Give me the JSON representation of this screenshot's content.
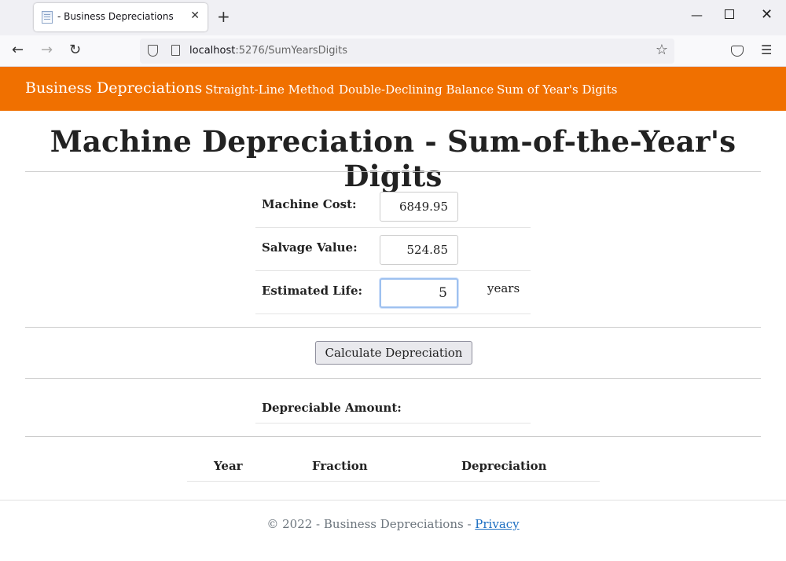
{
  "browser": {
    "tab_title": "- Business Depreciations",
    "tab_close": "✕",
    "new_tab": "+",
    "url_host": "localhost",
    "url_rest": ":5276/SumYearsDigits",
    "icons": [
      "back-arrow-icon",
      "forward-arrow-icon",
      "reload-icon",
      "shield-icon",
      "page-icon",
      "star-icon",
      "pocket-icon",
      "menu-icon"
    ]
  },
  "site": {
    "brand": "Business Depreciations",
    "nav": [
      "Straight-Line Method",
      "Double-Declining Balance",
      "Sum of Year's Digits"
    ],
    "accent_color": "#f07000"
  },
  "main": {
    "title": "Machine Depreciation - Sum-of-the-Year's Digits",
    "fields": [
      {
        "label": "Machine Cost:",
        "value": "6849.95"
      },
      {
        "label": "Salvage Value:",
        "value": "524.85"
      },
      {
        "label": "Estimated Life:",
        "value": "5",
        "unit": "years"
      }
    ],
    "calculate_label": "Calculate Depreciation",
    "depreciable_label": "Depreciable Amount:",
    "table_headers": [
      "Year",
      "Fraction",
      "Depreciation"
    ]
  },
  "footer": {
    "text": "© 2022 - Business Depreciations - ",
    "privacy": "Privacy"
  }
}
